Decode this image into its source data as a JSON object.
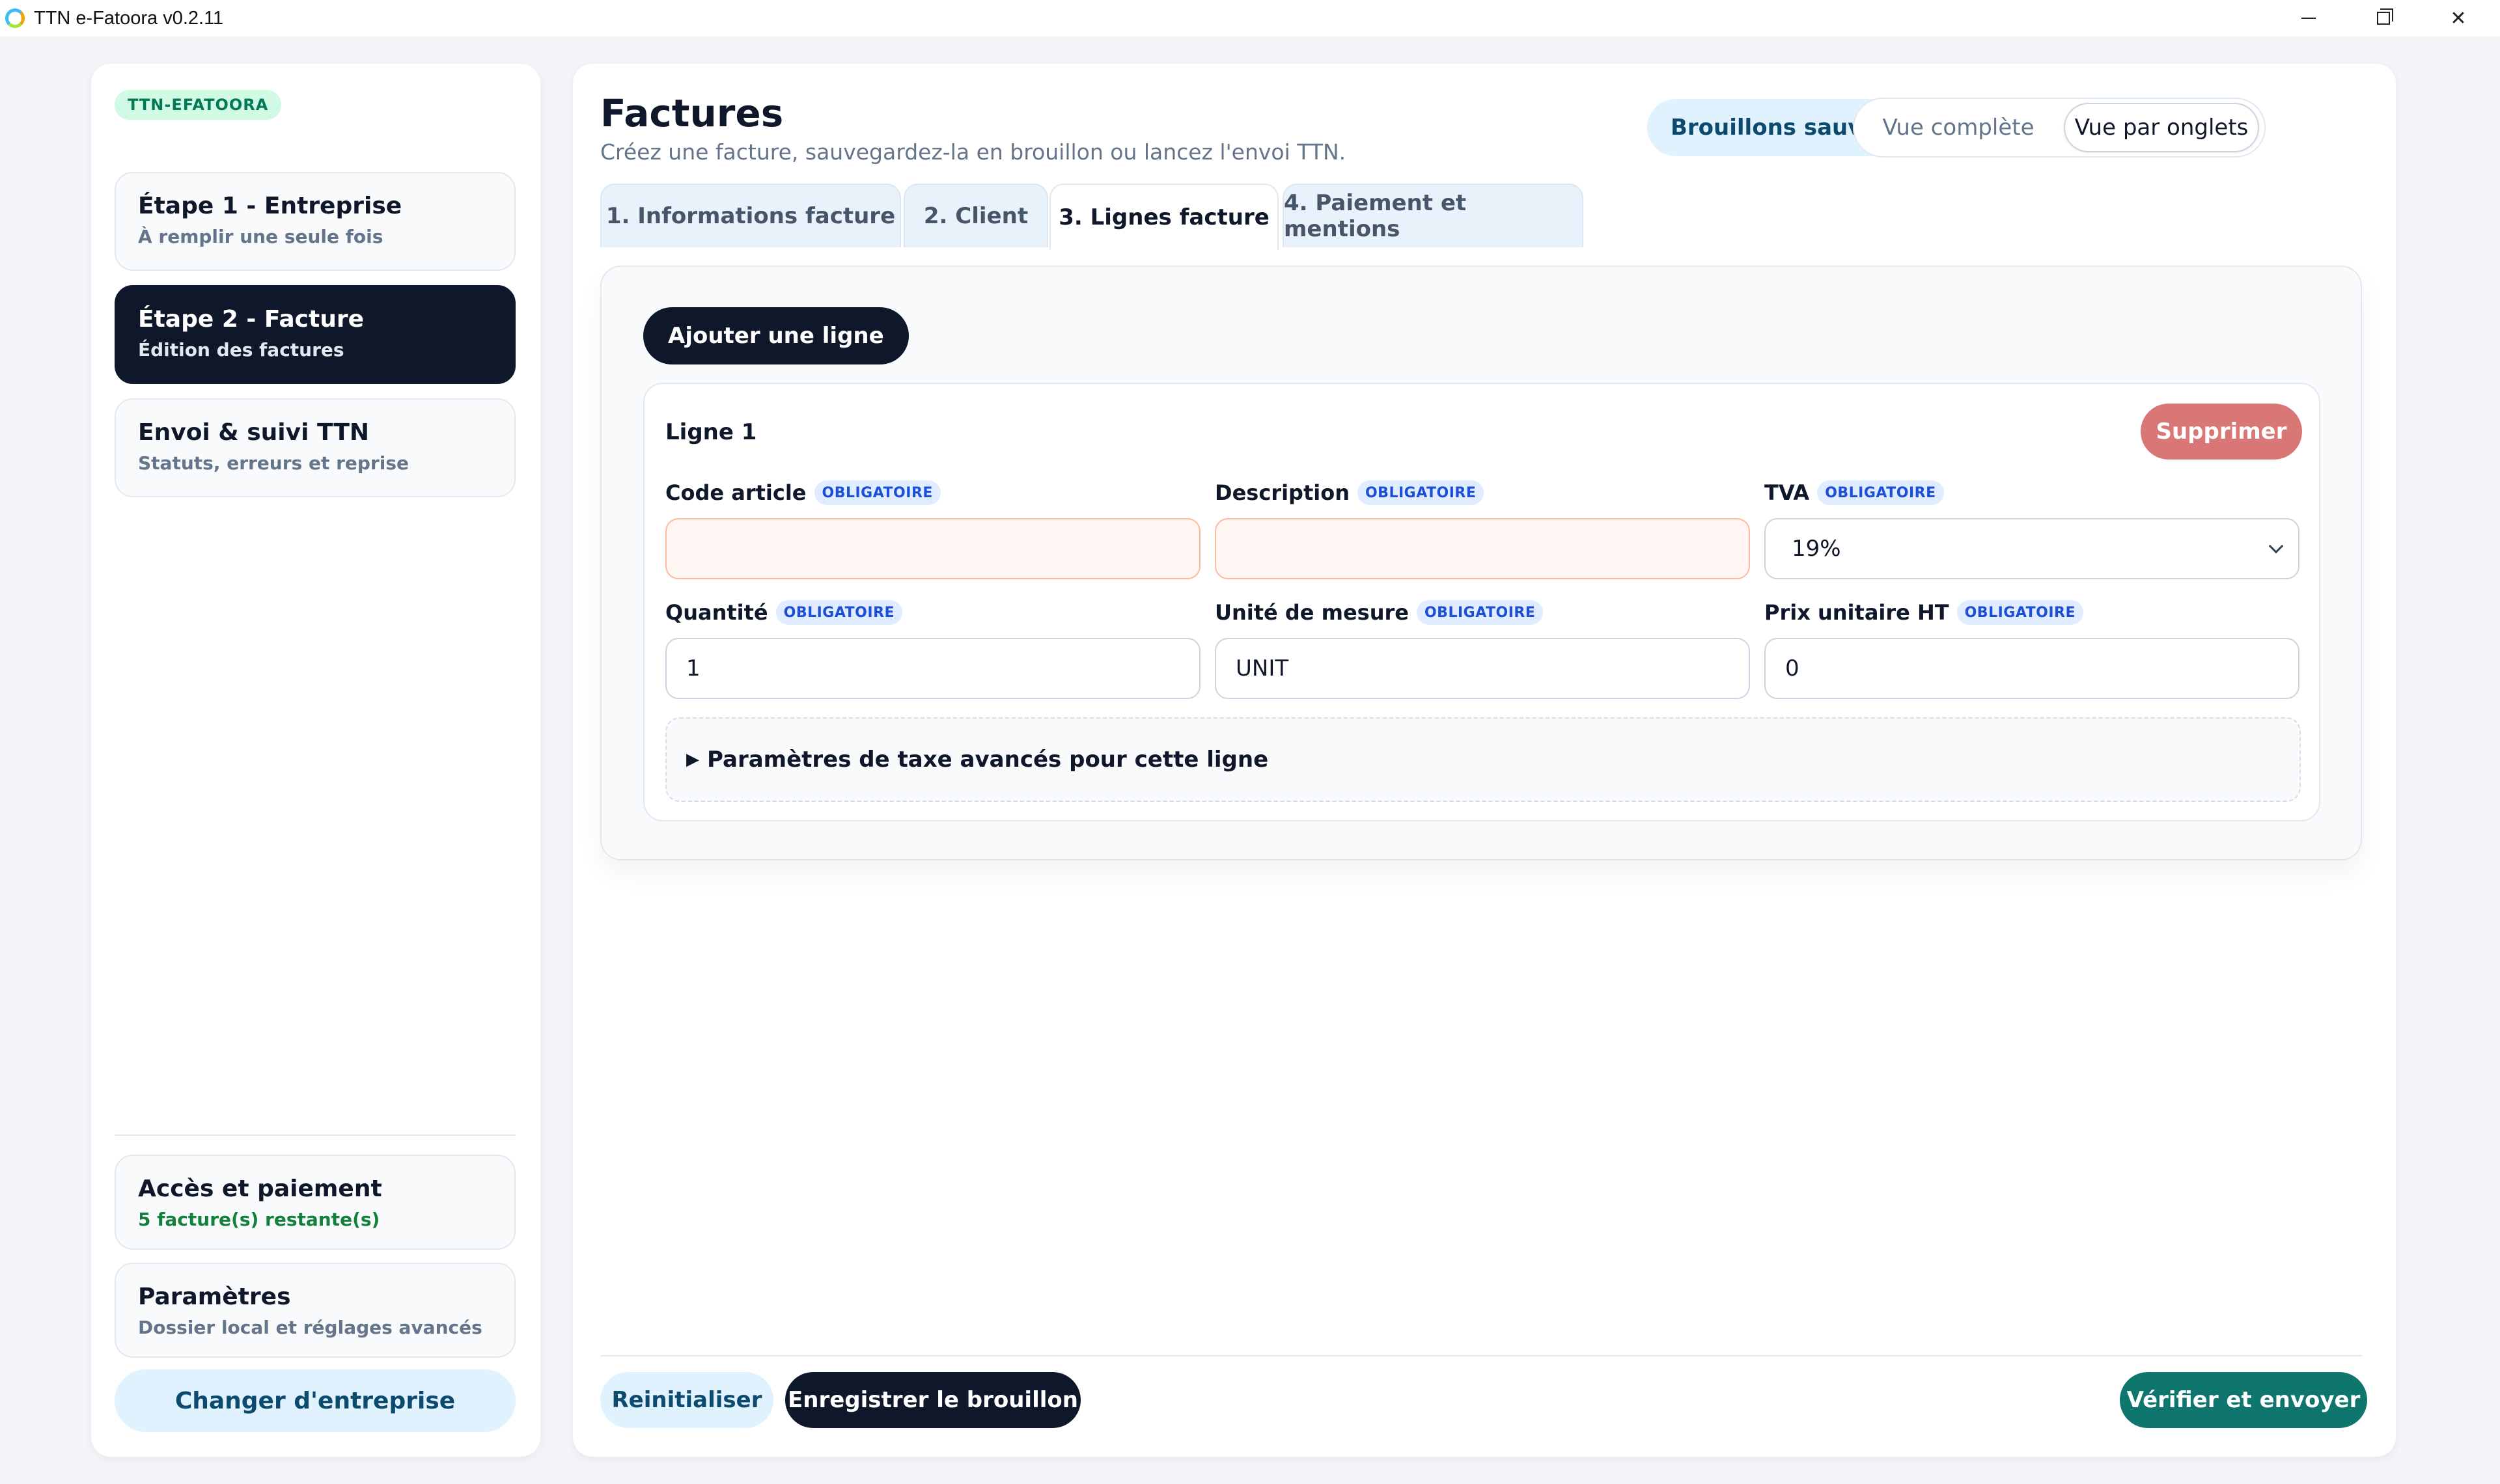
{
  "window": {
    "title": "TTN e-Fatoora v0.2.11",
    "controls": {
      "minimize": "minimize-icon",
      "maximize": "restore-icon",
      "close": "✕"
    }
  },
  "sidebar": {
    "brand": "TTN-EFATOORA",
    "steps": [
      {
        "title": "Étape 1 - Entreprise",
        "subtitle": "À remplir une seule fois",
        "active": false
      },
      {
        "title": "Étape 2 - Facture",
        "subtitle": "Édition des factures",
        "active": true
      },
      {
        "title": "Envoi & suivi TTN",
        "subtitle": "Statuts, erreurs et reprise",
        "active": false
      }
    ],
    "bottom": [
      {
        "title": "Accès et paiement",
        "subtitle": "5 facture(s) restante(s)"
      },
      {
        "title": "Paramètres",
        "subtitle": "Dossier local et réglages avancés"
      }
    ],
    "change_company": "Changer d'entreprise"
  },
  "header": {
    "title": "Factures",
    "subtitle": "Créez une facture, sauvegardez-la en brouillon ou lancez l'envoi TTN.",
    "drafts_button": "Brouillons sauvegardés",
    "view_toggle": {
      "full": "Vue complète",
      "tabs": "Vue par onglets",
      "selected": "Vue par onglets"
    }
  },
  "tabs": [
    {
      "label": "1. Informations facture",
      "active": false
    },
    {
      "label": "2. Client",
      "active": false
    },
    {
      "label": "3. Lignes facture",
      "active": true
    },
    {
      "label": "4. Paiement et mentions",
      "active": false
    }
  ],
  "lines": {
    "add_button": "Ajouter une ligne",
    "items": [
      {
        "title": "Ligne 1",
        "delete_button": "Supprimer",
        "required_badge": "OBLIGATOIRE",
        "fields": {
          "code": {
            "label": "Code article",
            "value": ""
          },
          "description": {
            "label": "Description",
            "value": ""
          },
          "tva": {
            "label": "TVA",
            "value": "19%"
          },
          "quantity": {
            "label": "Quantité",
            "value": "1"
          },
          "unit": {
            "label": "Unité de mesure",
            "value": "UNIT"
          },
          "price": {
            "label": "Prix unitaire HT",
            "value": "0"
          }
        },
        "advanced_label": "Paramètres de taxe avancés pour cette ligne"
      }
    ]
  },
  "footer": {
    "reset": "Reinitialiser",
    "save_draft": "Enregistrer le brouillon",
    "verify_send": "Vérifier et envoyer"
  },
  "colors": {
    "dark": "#0f172a",
    "accent_light": "#e0f2fe",
    "danger": "#d97777",
    "success": "#0f766e",
    "badge_green": "#d1fae5",
    "required_badge": "#e0ecff"
  }
}
